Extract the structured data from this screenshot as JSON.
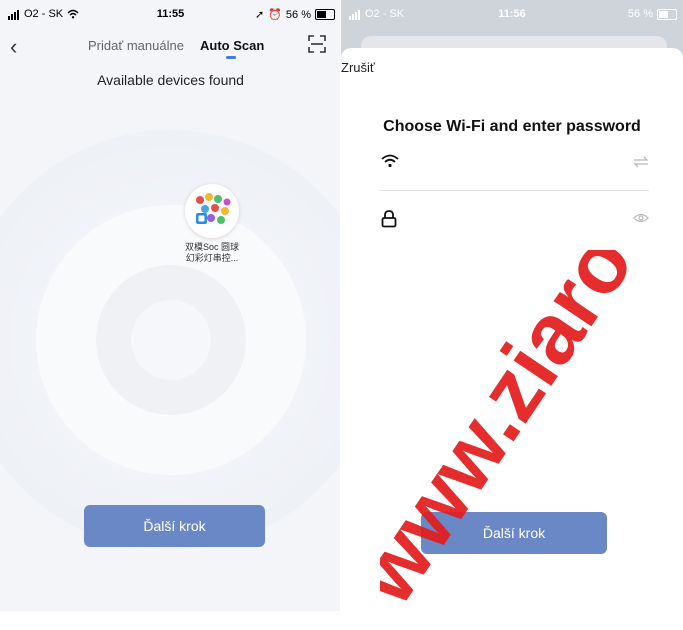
{
  "left": {
    "status": {
      "carrier": "O2 - SK",
      "time": "11:55",
      "battery": "56 %"
    },
    "nav": {
      "tab_manual": "Pridať manuálne",
      "tab_auto": "Auto Scan"
    },
    "found_title": "Available devices found",
    "device": {
      "name_line1": "双模Soc 圆球",
      "name_line2": "幻彩灯串控..."
    },
    "next_button": "Ďalší krok"
  },
  "right": {
    "status": {
      "carrier": "O2 - SK",
      "time": "11:56",
      "battery": "56 %"
    },
    "cancel": "Zrušiť",
    "title": "Choose Wi-Fi and enter password",
    "wifi_value": "",
    "password_value": "",
    "next_button": "Ďalší krok"
  },
  "watermark": "www.ziaro",
  "colors": {
    "accent": "#3f7ee8",
    "button": "#6b88c6",
    "watermark": "#e31c1c"
  },
  "icons": {
    "back": "chevron-left-icon",
    "scan": "scan-frame-icon",
    "wifi": "wifi-icon",
    "switch": "swap-arrows-icon",
    "lock": "lock-icon",
    "eye": "eye-icon"
  }
}
